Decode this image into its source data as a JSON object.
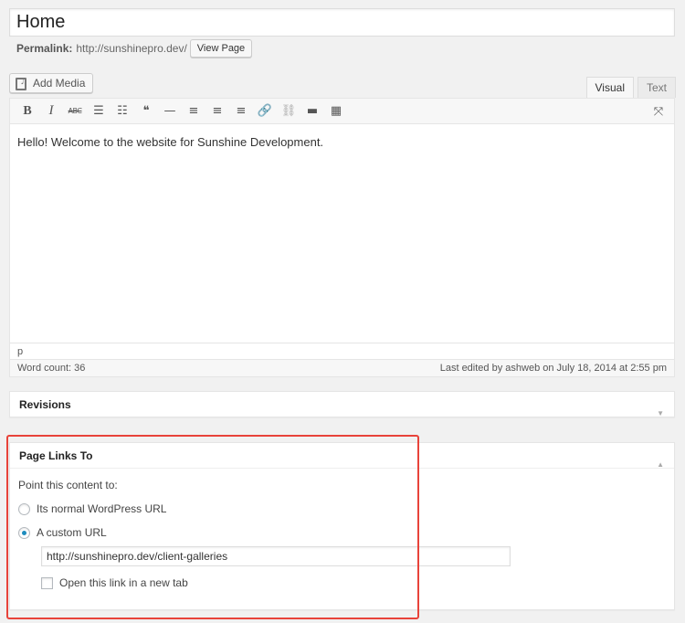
{
  "title": {
    "value": "Home"
  },
  "permalink": {
    "label": "Permalink:",
    "url": "http://sunshinepro.dev/",
    "view_button": "View Page"
  },
  "media": {
    "add_media_label": "Add Media"
  },
  "editor_tabs": {
    "visual": "Visual",
    "text": "Text"
  },
  "toolbar": {
    "bold": "B",
    "italic": "I",
    "strikethrough": "ABC",
    "bullet_list": "☰",
    "numbered_list": "☷",
    "blockquote": "❝",
    "hr": "—",
    "align_left": "≡",
    "align_center": "≡",
    "align_right": "≡",
    "link": "🔗",
    "unlink": "⛓",
    "read_more": "▬",
    "toolbar_toggle": "▦",
    "fullscreen": "⤧"
  },
  "editor": {
    "content": "Hello! Welcome to the website for Sunshine Development.",
    "path": "p",
    "word_count": "Word count: 36",
    "last_edited": "Last edited by ashweb on July 18, 2014 at 2:55 pm"
  },
  "revisions": {
    "title": "Revisions"
  },
  "page_links_to": {
    "title": "Page Links To",
    "prompt": "Point this content to:",
    "option_normal": "Its normal WordPress URL",
    "option_custom": "A custom URL",
    "custom_url_value": "http://sunshinepro.dev/client-galleries",
    "new_tab_label": "Open this link in a new tab",
    "selected": "custom",
    "new_tab_checked": false
  },
  "colors": {
    "highlight": "#e8433a",
    "radio_selected": "#1e8cbe"
  }
}
